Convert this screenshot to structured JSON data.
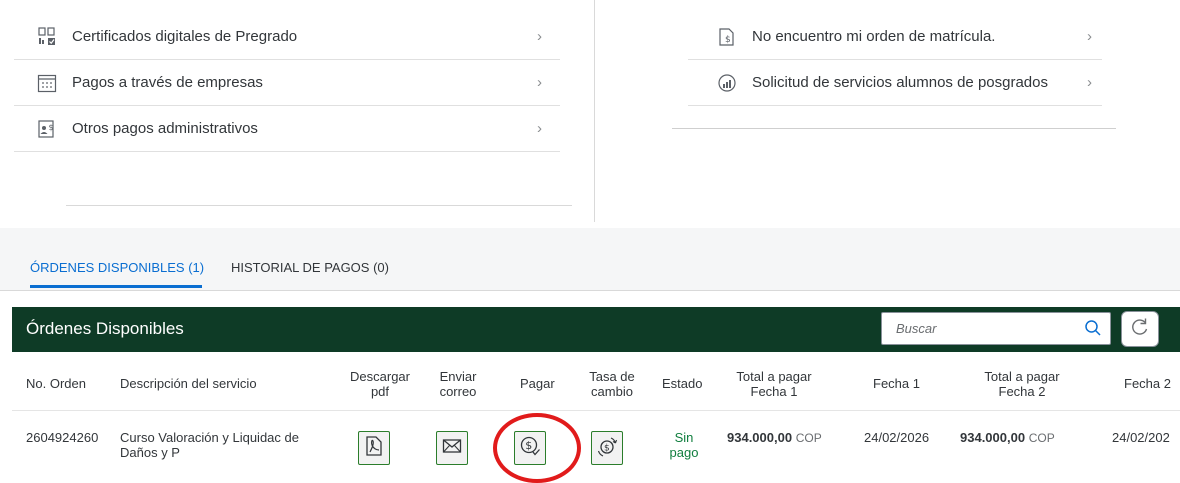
{
  "menu_left": [
    {
      "label": "Certificados digitales de Pregrado",
      "icon": "certificate-icon"
    },
    {
      "label": "Pagos a través de empresas",
      "icon": "calendar-grid-icon"
    },
    {
      "label": "Otros pagos administrativos",
      "icon": "admin-payment-icon"
    }
  ],
  "menu_right": [
    {
      "label": "No encuentro mi orden de matrícula.",
      "icon": "document-money-icon"
    },
    {
      "label": "Solicitud de servicios alumnos de posgrados",
      "icon": "service-request-icon"
    }
  ],
  "chevron": "›",
  "tabs": {
    "active": "ÓRDENES DISPONIBLES (1)",
    "inactive": "HISTORIAL DE PAGOS (0)"
  },
  "table": {
    "title": "Órdenes Disponibles",
    "search_placeholder": "Buscar",
    "columns": {
      "order": "No. Orden",
      "desc": "Descripción del servicio",
      "pdf_1": "Descargar",
      "pdf_2": "pdf",
      "mail_1": "Enviar",
      "mail_2": "correo",
      "pay": "Pagar",
      "rate_1": "Tasa de",
      "rate_2": "cambio",
      "status": "Estado",
      "total1_1": "Total a pagar",
      "total1_2": "Fecha 1",
      "date1": "Fecha 1",
      "total2_1": "Total a pagar",
      "total2_2": "Fecha 2",
      "date2": "Fecha 2"
    },
    "rows": [
      {
        "order": "2604924260",
        "desc_1": "Curso Valoración y Liquidac de",
        "desc_2": "Daños y P",
        "status_1": "Sin",
        "status_2": "pago",
        "total1": "934.000,00",
        "currency1": "COP",
        "date1": "24/02/2026",
        "total2": "934.000,00",
        "currency2": "COP",
        "date2": "24/02/202"
      }
    ]
  },
  "colors": {
    "header_bg": "#0e3b26",
    "accent": "#0a6ed1",
    "status_green": "#107e3e",
    "highlight": "#e11b1b"
  }
}
